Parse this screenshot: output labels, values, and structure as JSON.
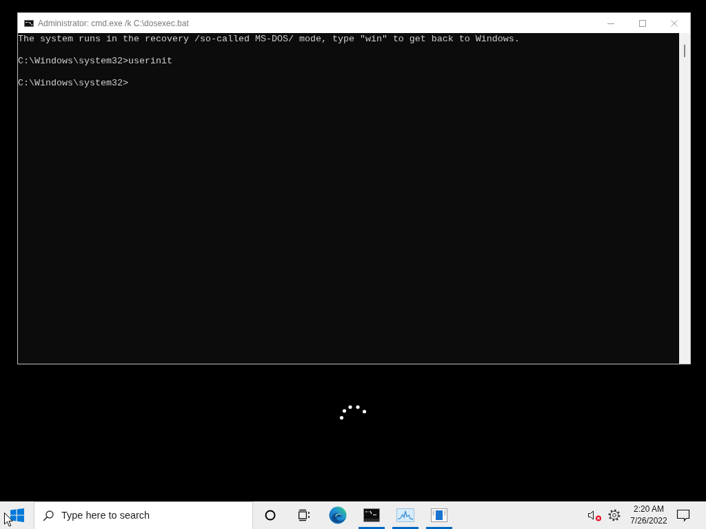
{
  "window": {
    "title": "Administrator: cmd.exe /k C:\\dosexec.bat",
    "console_lines": [
      "The system runs in the recovery /so-called MS-DOS/ mode, type \"win\" to get back to Windows.",
      "C:\\Windows\\system32>userinit",
      "C:\\Windows\\system32>"
    ]
  },
  "taskbar": {
    "search": {
      "placeholder": "Type here to search"
    },
    "buttons": [
      {
        "kind": "cortana",
        "running": false
      },
      {
        "kind": "task_view",
        "running": false
      },
      {
        "kind": "browser",
        "running": false
      },
      {
        "kind": "console",
        "running": true
      },
      {
        "kind": "monitor",
        "running": true
      },
      {
        "kind": "panel",
        "running": true
      }
    ],
    "tray": {
      "volume_muted": true
    },
    "clock": {
      "time": "2:20 AM",
      "date": "7/26/2022"
    }
  }
}
